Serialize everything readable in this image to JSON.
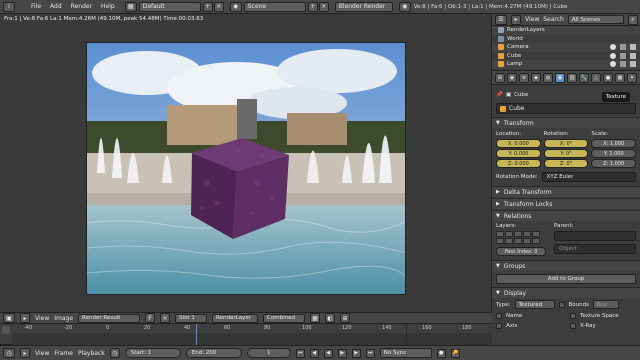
{
  "topbar": {
    "menus": [
      "File",
      "Add",
      "Render",
      "Help"
    ],
    "layout": "Default",
    "scene": "Scene",
    "engine": "Blender Render",
    "stats": "Ve:8 | Fa:6 | Ob:1-3 | La:1 | Mem:4.27M (49.10M) | Cube"
  },
  "viewport": {
    "render_info": "Fra:1 | Ve:8 Fa:6 La:1 Mem:4.26M (49.10M, peak 54.48M) Time:00:03.63"
  },
  "image_editor_header": {
    "view": "View",
    "image": "Image",
    "render_result": "Render Result",
    "f_label": "F",
    "slot": "Slot 1",
    "render_layer": "RenderLayer",
    "pass": "Combined"
  },
  "timeline": {
    "ticks": [
      "-40",
      "-20",
      "0",
      "20",
      "40",
      "60",
      "80",
      "100",
      "120",
      "140",
      "160",
      "180",
      "200",
      "220",
      "240",
      "260"
    ]
  },
  "bottombar": {
    "view": "View",
    "frame": "Frame",
    "playback": "Playback",
    "start": "Start: 1",
    "end": "End: 200",
    "current": "1",
    "sync": "No Sync"
  },
  "outliner": {
    "view": "View",
    "search": "Search",
    "scenes": "All Scenes",
    "rows": [
      {
        "label": "RenderLayers"
      },
      {
        "label": "World"
      },
      {
        "label": "Camera"
      },
      {
        "label": "Cube"
      },
      {
        "label": "Lamp"
      }
    ]
  },
  "properties": {
    "tooltip": "Texture",
    "breadcrumb": "Cube",
    "object_name": "Cube",
    "transform": {
      "header": "Transform",
      "location_label": "Location:",
      "rotation_label": "Rotation:",
      "scale_label": "Scale:",
      "location": [
        "X: 0.000",
        "Y: 0.000",
        "Z: 0.000"
      ],
      "rotation": [
        "X: 0°",
        "Y: 0°",
        "Z: 0°"
      ],
      "scale": [
        "X: 1.000",
        "Y: 1.000",
        "Z: 1.000"
      ],
      "rotation_mode_label": "Rotation Mode:",
      "rotation_mode": "XYZ Euler"
    },
    "delta_transform": "Delta Transform",
    "transform_locks": "Transform Locks",
    "relations": {
      "header": "Relations",
      "layers_label": "Layers:",
      "parent_label": "Parent:",
      "pass_index": "Pass Index: 0",
      "object_placeholder": "Object"
    },
    "groups": {
      "header": "Groups",
      "add_to_group": "Add to Group"
    },
    "display": {
      "header": "Display",
      "type_label": "Type:",
      "type_value": "Textured",
      "bounds": "Bounds",
      "box": "Box",
      "name": "Name",
      "texture_space": "Texture Space",
      "axis": "Axis",
      "xray": "X-Ray"
    }
  },
  "colors": {
    "accent_blue": "#5a8fce",
    "panel_bg": "#3d3d3d",
    "header_bg": "#474747"
  }
}
